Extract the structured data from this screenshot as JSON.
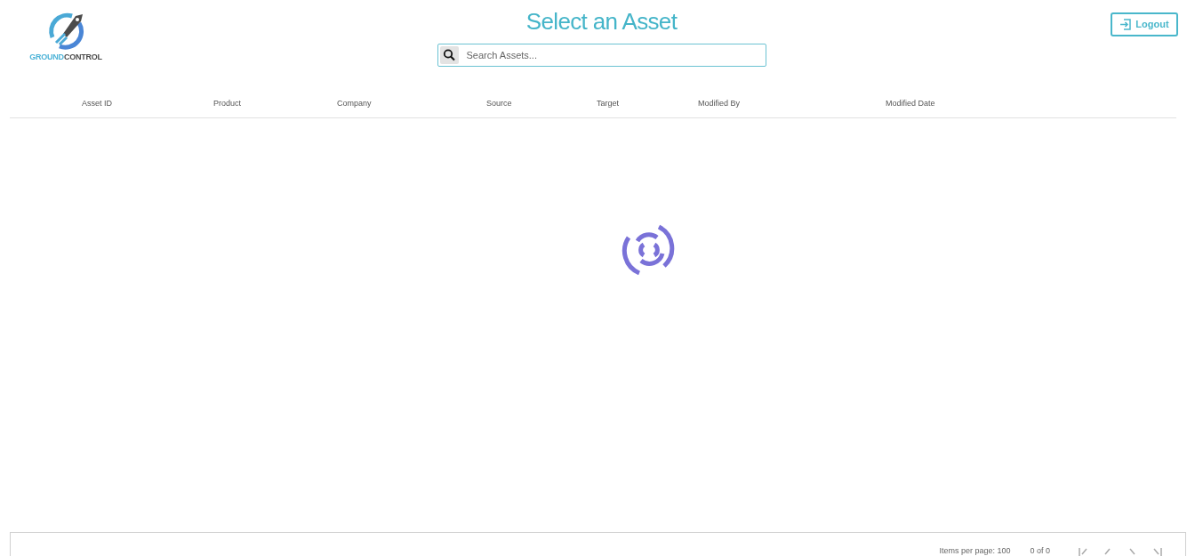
{
  "logo": {
    "part_1": "GROUND",
    "part_2": "CONTROL"
  },
  "title": "Select an Asset",
  "search": {
    "placeholder": "Search Assets..."
  },
  "logout_button": "Logout",
  "table": {
    "columns": [
      "Asset ID",
      "Product",
      "Company",
      "Source",
      "Target",
      "Modified By",
      "Modified Date"
    ]
  },
  "paginator": {
    "items_per_page_label": "Items per page:",
    "page_size": "100",
    "range": "0 of 0"
  }
}
